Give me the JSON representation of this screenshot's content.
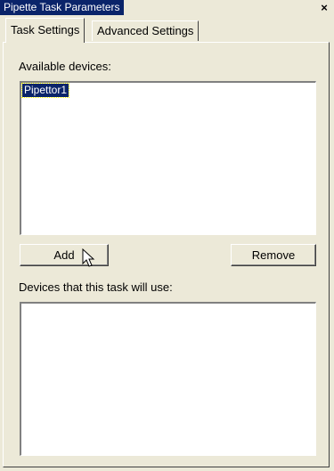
{
  "window": {
    "title": "Pipette Task Parameters",
    "close_glyph": "×"
  },
  "tabs": [
    {
      "label": "Task Settings",
      "active": true
    },
    {
      "label": "Advanced Settings",
      "active": false
    }
  ],
  "available_devices": {
    "label": "Available devices:",
    "items": [
      {
        "label": "Pipettor1",
        "selected": true
      }
    ]
  },
  "buttons": {
    "add_label": "Add",
    "remove_label": "Remove"
  },
  "task_devices": {
    "label": "Devices that this task will use:",
    "items": []
  },
  "colors": {
    "title_bar": "#0a246a",
    "selection": "#0a246a",
    "face": "#ece9d8"
  },
  "icons": {
    "close": "close-icon",
    "pointer": "mouse-pointer-icon"
  }
}
